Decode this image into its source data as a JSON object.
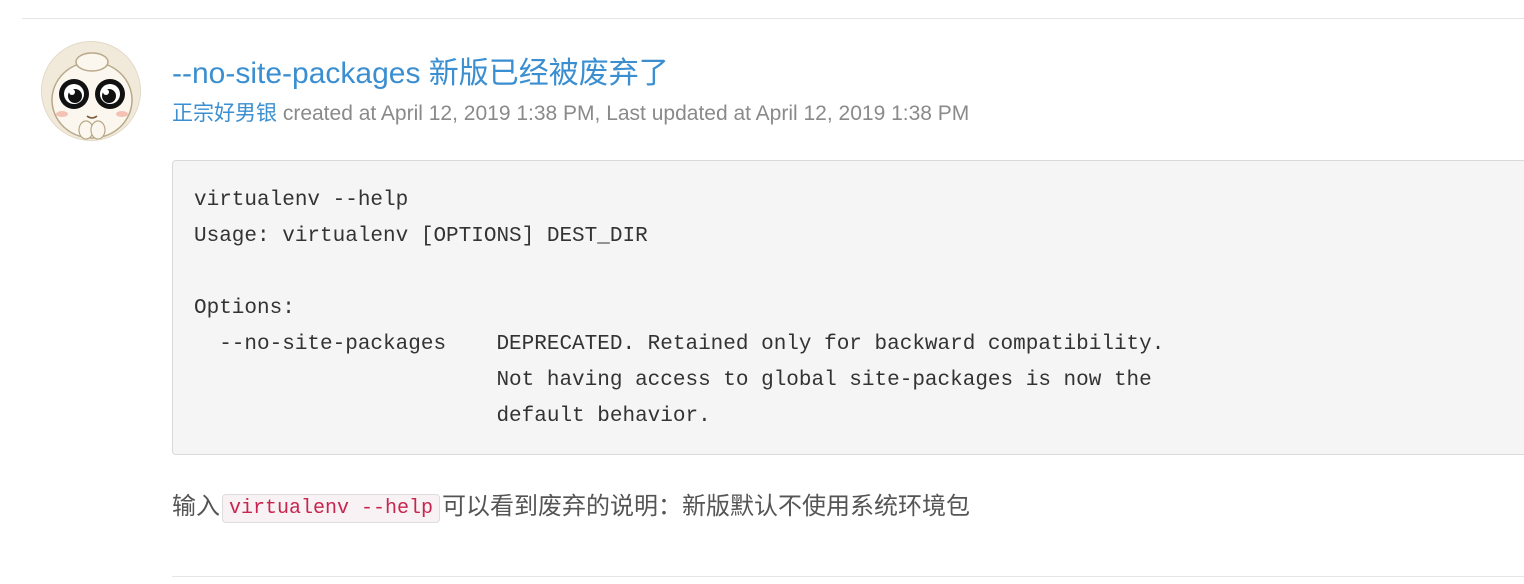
{
  "post": {
    "title": "--no-site-packages 新版已经被废弃了",
    "author": "正宗好男银",
    "meta_text": " created at April 12, 2019 1:38 PM, Last updated at April 12, 2019 1:38 PM",
    "avatar_icon": "cartoon-face-avatar"
  },
  "code_block": {
    "text": "virtualenv --help\nUsage: virtualenv [OPTIONS] DEST_DIR\n\nOptions:\n  --no-site-packages    DEPRECATED. Retained only for backward compatibility.\n                        Not having access to global site-packages is now the\n                        default behavior."
  },
  "body": {
    "prefix": "输入",
    "inline_code": "virtualenv --help",
    "suffix": "可以看到废弃的说明：新版默认不使用系统环境包"
  },
  "colors": {
    "link": "#3b8fd0",
    "meta": "#8a8a8a",
    "code_bg": "#f5f5f5",
    "inline_code": "#c7254e"
  }
}
